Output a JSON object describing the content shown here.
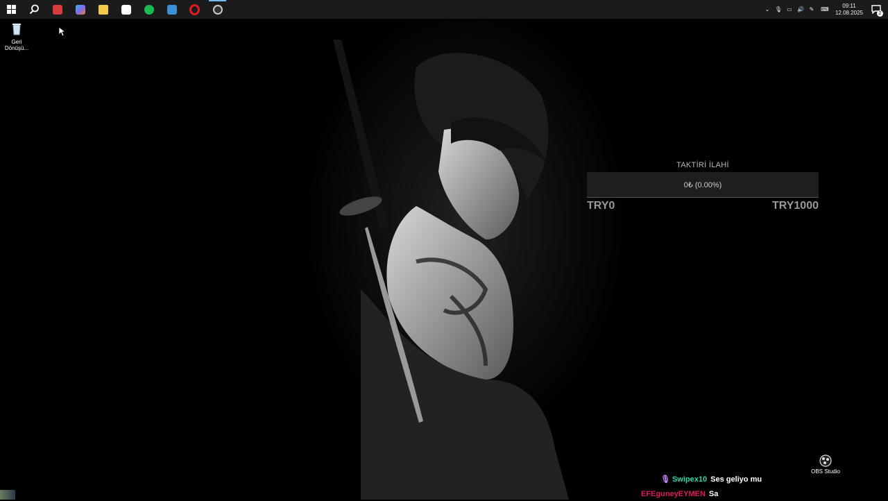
{
  "taskbar": {
    "apps": [
      {
        "name": "start-icon",
        "color": "#ffffff"
      },
      {
        "name": "search-icon",
        "color": "#ffffff"
      },
      {
        "name": "office-app-icon",
        "color": "#d83b3b"
      },
      {
        "name": "copilot-icon",
        "color": "#7a6cf0"
      },
      {
        "name": "file-explorer-icon",
        "color": "#f2c94c"
      },
      {
        "name": "store-icon",
        "color": "#ffffff"
      },
      {
        "name": "spotify-icon",
        "color": "#1db954"
      },
      {
        "name": "mail-icon",
        "color": "#3a8fd8"
      },
      {
        "name": "opera-icon",
        "color": "#e11b22"
      },
      {
        "name": "obs-app-icon",
        "color": "#cccccc"
      }
    ],
    "clock": {
      "time": "09:11",
      "date": "12.08.2025"
    },
    "notifications_count": "2"
  },
  "desktop": {
    "recycle_bin_label_line1": "Geri",
    "recycle_bin_label_line2": "Dönüşü...",
    "obs_label": "OBS Studio"
  },
  "donation": {
    "title": "TAKTİRİ İLAHİ",
    "progress_text": "0₺ (0.00%)",
    "progress_fraction": 0,
    "min_label": "TRY0",
    "max_label": "TRY1000"
  },
  "chat": [
    {
      "user": "Swipex10",
      "user_color": "#2fd6a6",
      "message": "Ses geliyo mu",
      "has_badge": true
    },
    {
      "user": "EFEguneyEYMEN",
      "user_color": "#e0195a",
      "message": "Sa",
      "has_badge": false
    }
  ]
}
